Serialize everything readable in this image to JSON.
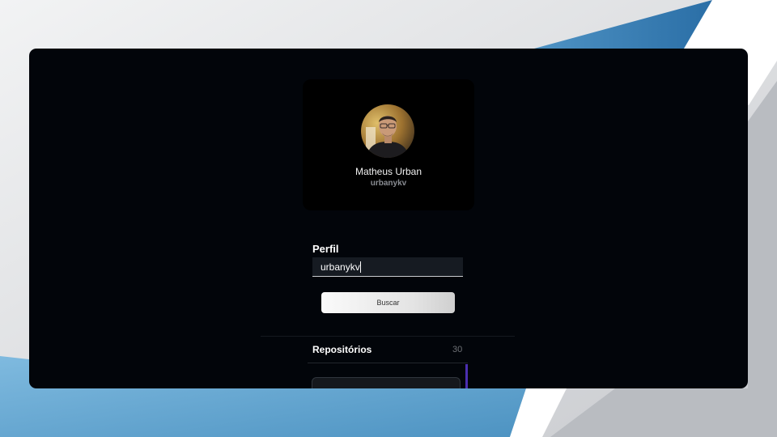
{
  "profile": {
    "name": "Matheus Urban",
    "login": "urbanykv",
    "avatar_icon": "user-photo"
  },
  "search": {
    "label": "Perfil",
    "value": "urbanykv",
    "button_label": "Buscar"
  },
  "repositories": {
    "title": "Repositórios",
    "count": "30"
  },
  "colors": {
    "window_background": "#02050a",
    "card_background": "#000000",
    "input_background": "#161b22",
    "scrollbar_accent": "#4b2fb0",
    "wallpaper_blue": "#5ea4cf"
  }
}
